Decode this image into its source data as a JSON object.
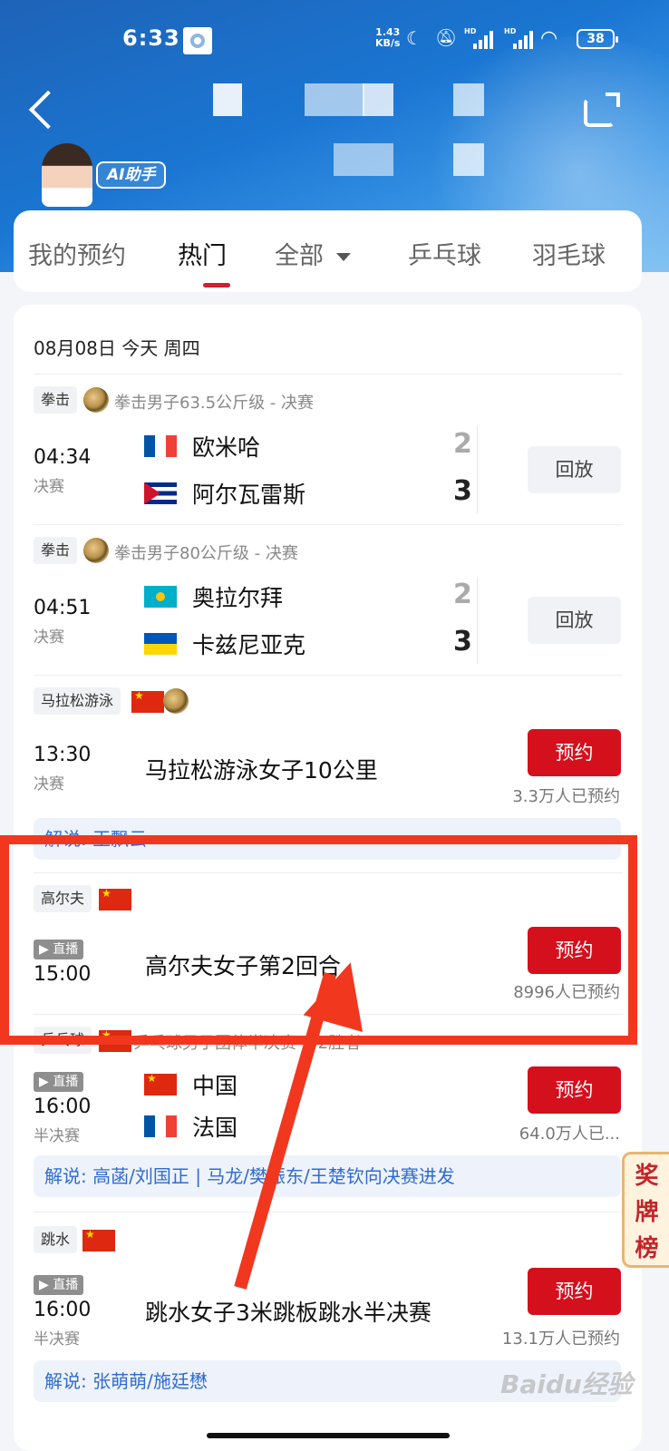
{
  "status_bar": {
    "time": "6:33",
    "speed_top": "1.43",
    "speed_bottom": "KB/s",
    "battery": "38"
  },
  "header": {
    "ai_badge": "AI助手"
  },
  "tabs": [
    {
      "label": "我的预约"
    },
    {
      "label": "热门"
    },
    {
      "label": "全部"
    },
    {
      "label": "乒乓球"
    },
    {
      "label": "羽毛球"
    }
  ],
  "date_label": "08月08日 今天 周四",
  "events": [
    {
      "sport": "拳击",
      "title": "拳击男子63.5公斤级 - 决赛",
      "time": "04:34",
      "stage": "决赛",
      "team_a": "欧米哈",
      "team_b": "阿尔瓦雷斯",
      "score_a": "2",
      "score_b": "3",
      "button": "回放"
    },
    {
      "sport": "拳击",
      "title": "拳击男子80公斤级 - 决赛",
      "time": "04:51",
      "stage": "决赛",
      "team_a": "奥拉尔拜",
      "team_b": "卡兹尼亚克",
      "score_a": "2",
      "score_b": "3",
      "button": "回放"
    },
    {
      "sport": "马拉松游泳",
      "title": "马拉松游泳女子10公里",
      "time": "13:30",
      "stage": "决赛",
      "button": "预约",
      "count": "3.3万人已预约",
      "commentary": "解说: 王飘云"
    },
    {
      "sport": "高尔夫",
      "title": "高尔夫女子第2回合",
      "live": "▶ 直播",
      "time": "15:00",
      "button": "预约",
      "count": "8996人已预约"
    },
    {
      "sport": "乒乓球",
      "title": "乒乓球男子团体半决赛 1-2胜者",
      "live": "▶ 直播",
      "time": "16:00",
      "stage": "半决赛",
      "team_a": "中国",
      "team_b": "法国",
      "button": "预约",
      "count": "64.0万人已...",
      "commentary": "解说: 高菡/刘国正 | 马龙/樊振东/王楚钦向决赛进发"
    },
    {
      "sport": "跳水",
      "title": "跳水女子3米跳板跳水半决赛",
      "live": "▶ 直播",
      "time": "16:00",
      "stage": "半决赛",
      "button": "预约",
      "count": "13.1万人已预约",
      "commentary": "解说: 张萌萌/施廷懋"
    }
  ],
  "medal_tab": {
    "l1": "奖",
    "l2": "牌",
    "l3": "榜"
  },
  "watermark": "Baidu经验",
  "colors": {
    "header_blue": "#1a76d2",
    "accent_red": "#d4101c",
    "annotation_red": "#f2371f",
    "commentary_blue": "#2f6bd0"
  },
  "icons": [
    "back-arrow-icon",
    "share-icon",
    "moon-icon",
    "mute-bell-icon",
    "wifi-icon",
    "signal-icon",
    "battery-icon",
    "medal-icon",
    "flag-icon",
    "live-play-icon"
  ]
}
